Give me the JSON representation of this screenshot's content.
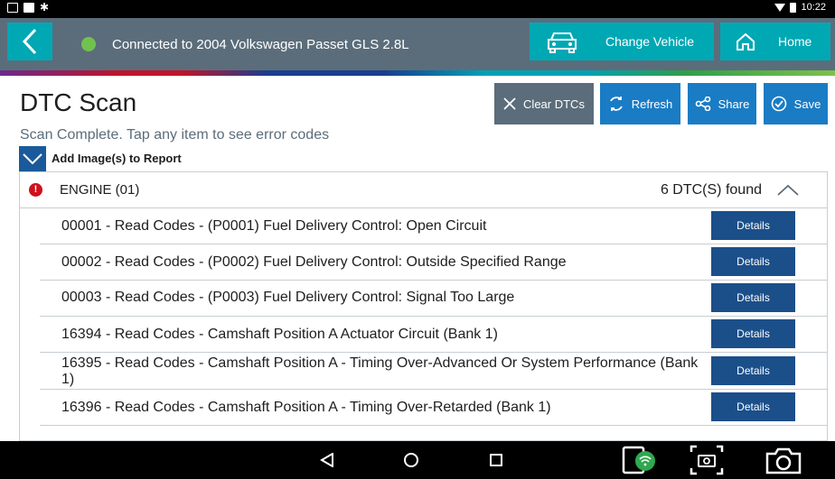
{
  "status_bar": {
    "time": "10:22"
  },
  "header": {
    "connection_text": "Connected to 2004 Volkswagen Passet GLS 2.8L",
    "change_vehicle_label": "Change Vehicle",
    "home_label": "Home"
  },
  "page": {
    "title": "DTC Scan",
    "subtitle": "Scan Complete. Tap any item to see error codes",
    "add_images_label": "Add Image(s) to Report"
  },
  "actions": {
    "clear": "Clear DTCs",
    "refresh": "Refresh",
    "share": "Share",
    "save": "Save"
  },
  "group": {
    "name": "ENGINE (01)",
    "count": "6 DTC(S) found",
    "rows": [
      {
        "text": "00001 - Read Codes - (P0001) Fuel Delivery Control: Open Circuit",
        "button": "Details"
      },
      {
        "text": "00002 - Read Codes - (P0002) Fuel Delivery Control: Outside Specified Range",
        "button": "Details"
      },
      {
        "text": "00003 - Read Codes - (P0003) Fuel Delivery Control: Signal Too Large",
        "button": "Details"
      },
      {
        "text": "16394 - Read Codes - Camshaft Position A Actuator Circuit (Bank 1)",
        "button": "Details"
      },
      {
        "text": "16395 - Read Codes - Camshaft Position A - Timing Over-Advanced Or System Performance (Bank 1)",
        "button": "Details"
      },
      {
        "text": "16396 - Read Codes - Camshaft Position A - Timing Over-Retarded (Bank 1)",
        "button": "Details"
      }
    ]
  },
  "colors": {
    "header_bg": "#5b6d7b",
    "accent_teal": "#00a8b4",
    "action_blue": "#1a7cc4",
    "details_blue": "#1b4f8a",
    "status_green": "#72c14f",
    "error_red": "#d0101c"
  }
}
